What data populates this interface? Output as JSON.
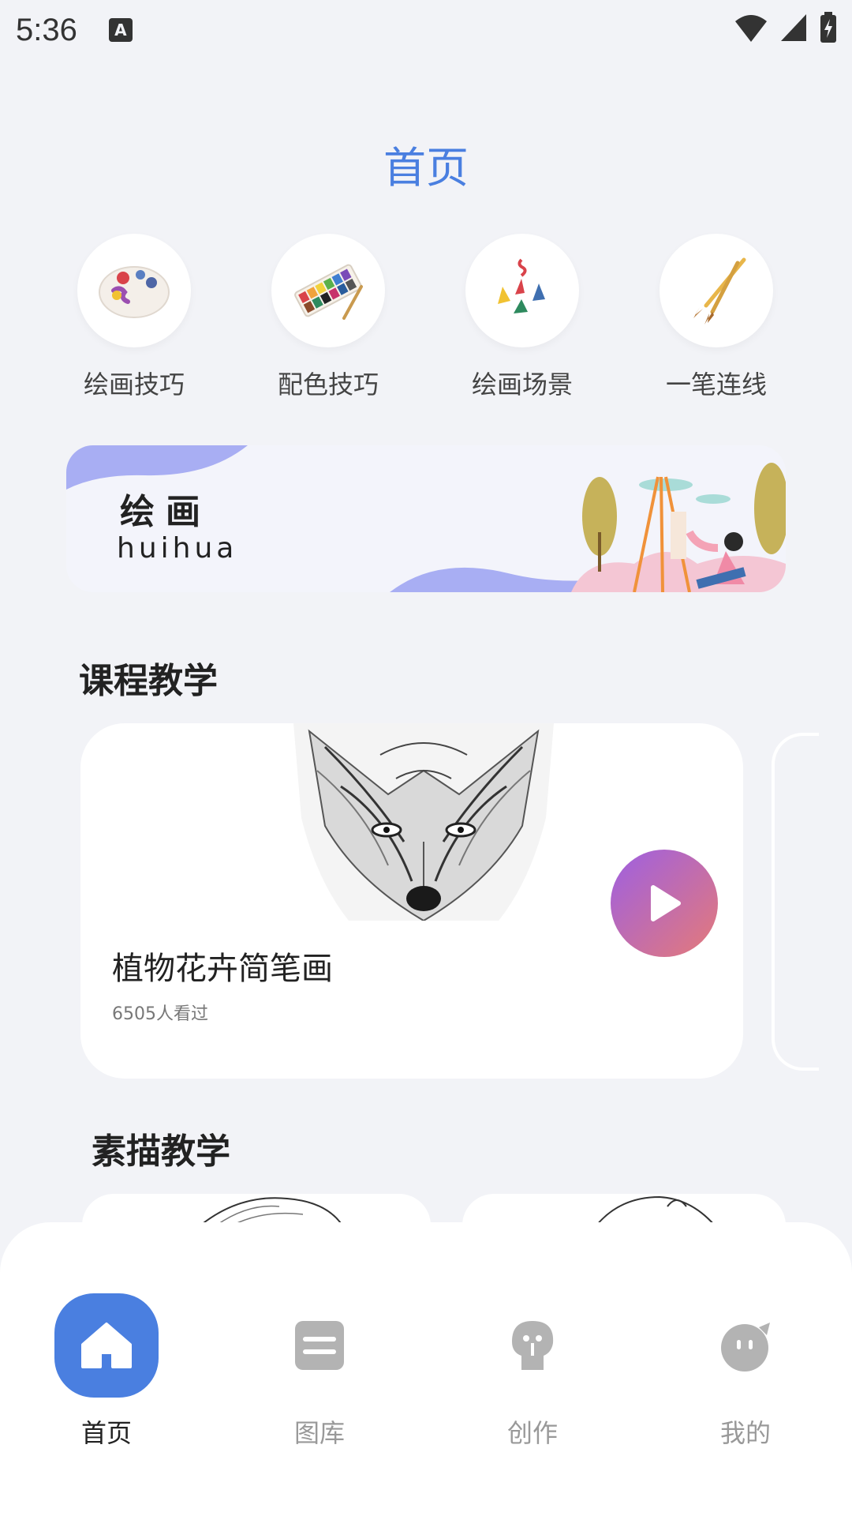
{
  "status": {
    "time": "5:36"
  },
  "header": {
    "title": "首页"
  },
  "categories": [
    {
      "label": "绘画技巧",
      "icon": "palette-icon"
    },
    {
      "label": "配色技巧",
      "icon": "watercolor-box-icon"
    },
    {
      "label": "绘画场景",
      "icon": "scene-icon"
    },
    {
      "label": "一笔连线",
      "icon": "brushes-icon"
    }
  ],
  "banner": {
    "title": "绘画",
    "subtitle": "huihua"
  },
  "course_section": {
    "title": "课程教学"
  },
  "course_card": {
    "name": "植物花卉简笔画",
    "views": "6505人看过"
  },
  "sketch_section": {
    "title": "素描教学"
  },
  "tabbar": {
    "items": [
      {
        "label": "首页",
        "icon": "home-icon",
        "active": true
      },
      {
        "label": "图库",
        "icon": "gallery-icon",
        "active": false
      },
      {
        "label": "创作",
        "icon": "create-icon",
        "active": false
      },
      {
        "label": "我的",
        "icon": "profile-icon",
        "active": false
      }
    ]
  },
  "colors": {
    "accent": "#4a7fe0",
    "background": "#f2f3f7",
    "play_gradient_start": "#9d5fe3",
    "play_gradient_end": "#e57a78"
  }
}
